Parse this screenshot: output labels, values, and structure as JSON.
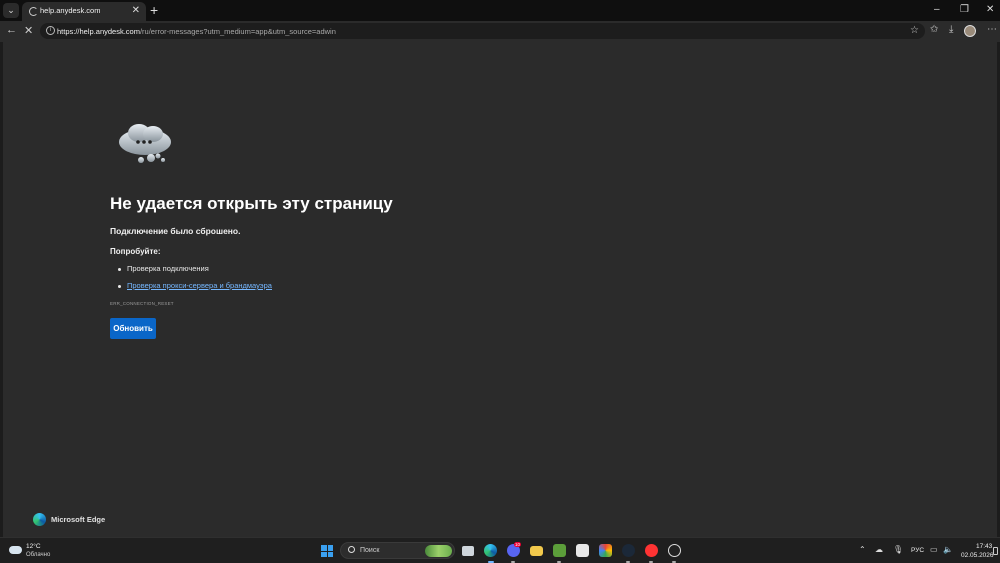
{
  "browser": {
    "tab_title": "help.anydesk.com",
    "url_host": "https://help.anydesk.com",
    "url_path": "/ru/error-messages?utm_medium=app&utm_source=adwin"
  },
  "error_page": {
    "heading": "Не удается открыть эту страницу",
    "subtitle": "Подключение было сброшено.",
    "try_label": "Попробуйте:",
    "suggestions": [
      "Проверка подключения",
      "Проверка прокси-сервера и брандмауэра"
    ],
    "error_code": "ERR_CONNECTION_RESET",
    "reload_label": "Обновить",
    "brand": "Microsoft Edge"
  },
  "taskbar": {
    "weather_temp": "12°C",
    "weather_condition": "Облачно",
    "search_placeholder": "Поиск",
    "language": "РУС",
    "time": "17:43",
    "date": "02.05.2026",
    "discord_badge": "10",
    "apps": [
      "task-view",
      "edge",
      "discord",
      "file-explorer",
      "minecraft",
      "store",
      "office",
      "steam",
      "yandex-browser",
      "obs"
    ]
  },
  "colors": {
    "accent": "#0a66c8",
    "link": "#75b7ff",
    "page_bg": "#2b2b2b"
  }
}
